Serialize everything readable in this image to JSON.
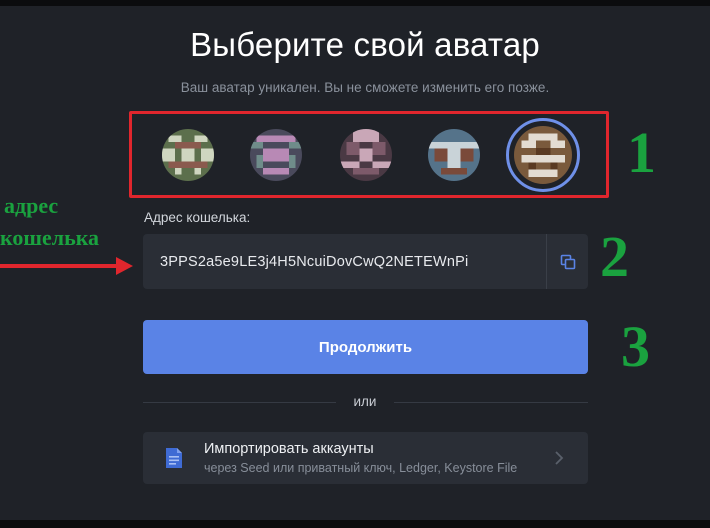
{
  "header": {
    "title": "Выберите свой аватар",
    "subtitle": "Ваш аватар уникален. Вы не сможете изменить его позже."
  },
  "avatars": [
    {
      "name": "avatar-1",
      "selected": false,
      "colors": [
        "#5c6f4c",
        "#cfd6c0",
        "#8a5a4e"
      ]
    },
    {
      "name": "avatar-2",
      "selected": false,
      "colors": [
        "#4a4a5c",
        "#b889b5",
        "#6f8c8a"
      ]
    },
    {
      "name": "avatar-3",
      "selected": false,
      "colors": [
        "#4a3944",
        "#c9a7b7",
        "#7d5a6a"
      ]
    },
    {
      "name": "avatar-4",
      "selected": false,
      "colors": [
        "#55738a",
        "#c9d3d8",
        "#7a4a3a"
      ]
    },
    {
      "name": "avatar-5",
      "selected": true,
      "colors": [
        "#7a5a3c",
        "#e3dcd2",
        "#5a3a22"
      ]
    }
  ],
  "wallet": {
    "label": "Адрес кошелька:",
    "address": "3PPS2a5e9LE3j4H5NcuiDovCwQ2NETEWnPi",
    "copy_icon": "copy-icon"
  },
  "continue_button": {
    "label": "Продолжить",
    "color": "#5a83e6"
  },
  "divider": {
    "text": "или"
  },
  "import": {
    "title": "Импортировать аккаунты",
    "subtitle": "через Seed или приватный ключ, Ledger, Keystore File",
    "icon": "document-icon"
  },
  "annotations": {
    "num_1": "1",
    "num_2": "2",
    "num_3": "3",
    "side_line_1": "адрес",
    "side_line_2": "кошелька",
    "color": "#1aa23f",
    "box_color": "#e0262d"
  }
}
